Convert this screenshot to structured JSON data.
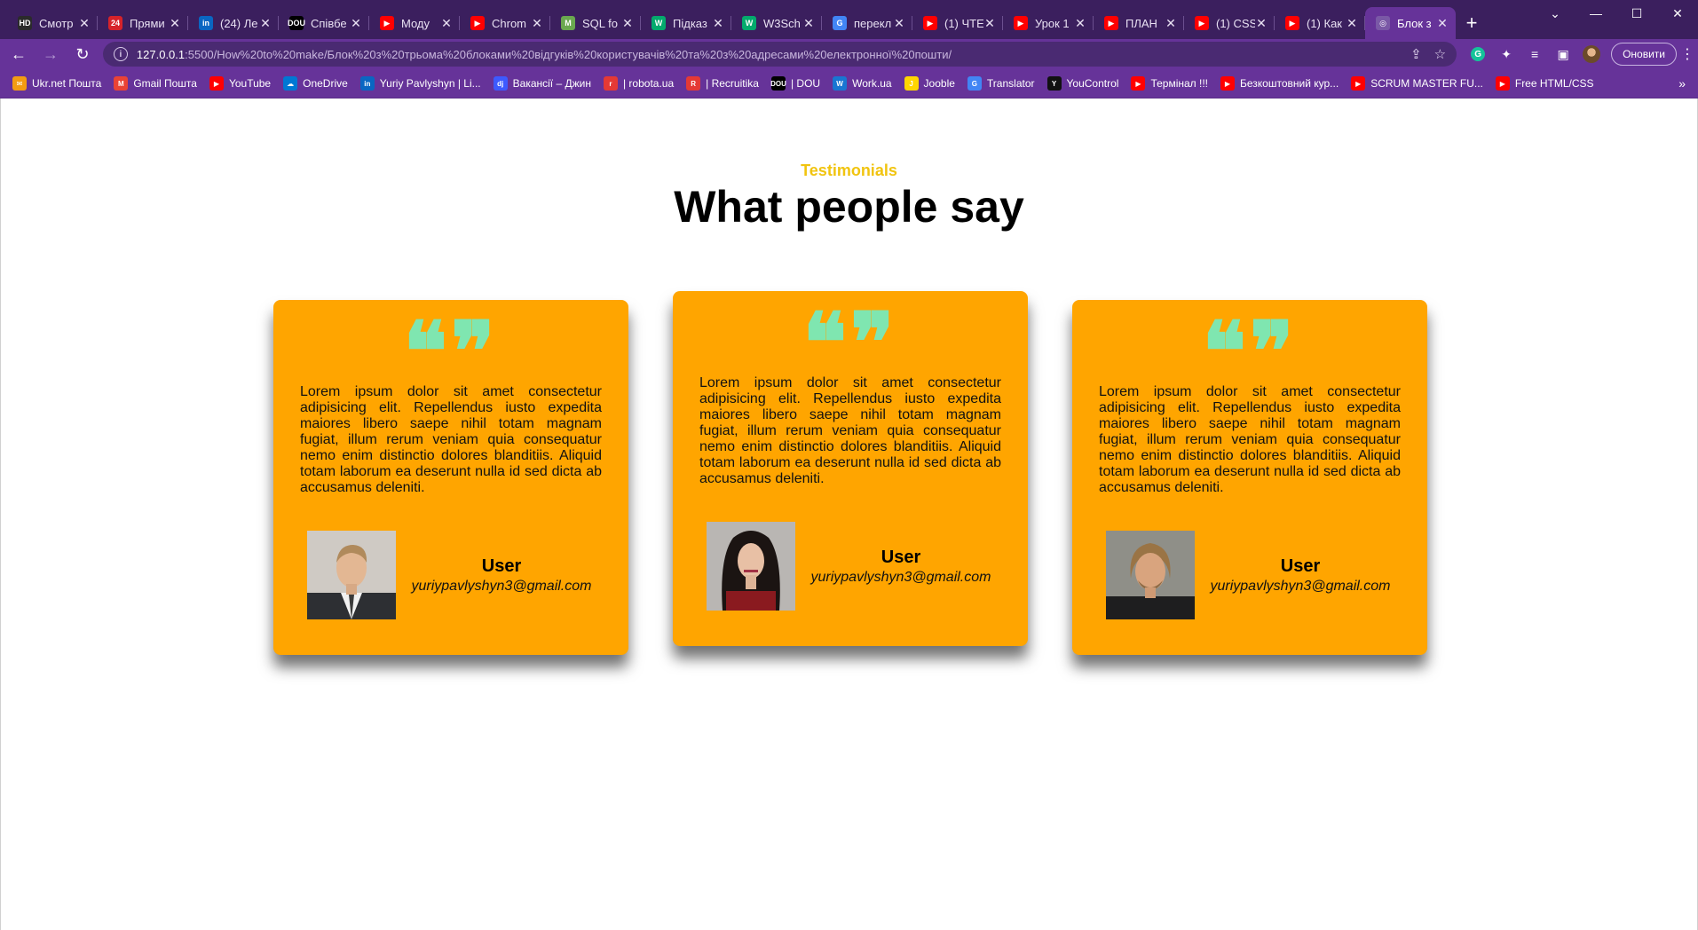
{
  "browser": {
    "tabs": [
      {
        "title": "Смотр",
        "fav_text": "HD",
        "fav_color": "#2b2b2b"
      },
      {
        "title": "Прями",
        "fav_text": "24",
        "fav_color": "#d6232a"
      },
      {
        "title": "(24) Ле",
        "fav_text": "in",
        "fav_color": "#0a66c2"
      },
      {
        "title": "Співбе",
        "fav_text": "DOU",
        "fav_color": "#000000"
      },
      {
        "title": "Моду",
        "fav_text": "▶",
        "fav_color": "#ff0000"
      },
      {
        "title": "Chrom",
        "fav_text": "▶",
        "fav_color": "#ff0000"
      },
      {
        "title": "SQL fo",
        "fav_text": "M",
        "fav_color": "#6aa84f"
      },
      {
        "title": "Підказ",
        "fav_text": "W",
        "fav_color": "#04aa6d"
      },
      {
        "title": "W3Sch",
        "fav_text": "W",
        "fav_color": "#04aa6d"
      },
      {
        "title": "перекл",
        "fav_text": "G",
        "fav_color": "#4285f4"
      },
      {
        "title": "(1) ЧТЕ",
        "fav_text": "▶",
        "fav_color": "#ff0000"
      },
      {
        "title": "Урок 1",
        "fav_text": "▶",
        "fav_color": "#ff0000"
      },
      {
        "title": "ПЛАН",
        "fav_text": "▶",
        "fav_color": "#ff0000"
      },
      {
        "title": "(1) CSS",
        "fav_text": "▶",
        "fav_color": "#ff0000"
      },
      {
        "title": "(1) Как",
        "fav_text": "▶",
        "fav_color": "#ff0000"
      },
      {
        "title": "Блок з",
        "fav_text": "◎",
        "fav_color": "#7a58a6",
        "active": true
      }
    ],
    "new_tab": "+",
    "close_glyph": "✕",
    "address": {
      "host": "127.0.0.1",
      "rest": ":5500/How%20to%20make/Блок%20з%20трьома%20блоками%20відгуків%20користувачів%20та%20з%20адресами%20електронної%20пошти/"
    },
    "update_label": "Оновити",
    "bookmarks": [
      {
        "label": "Ukr.net Пошта",
        "icon_color": "#f39c12",
        "icon_text": "✉"
      },
      {
        "label": "Gmail Пошта",
        "icon_color": "#ea4335",
        "icon_text": "M"
      },
      {
        "label": "YouTube",
        "icon_color": "#ff0000",
        "icon_text": "▶"
      },
      {
        "label": "OneDrive",
        "icon_color": "#0078d4",
        "icon_text": "☁"
      },
      {
        "label": "Yuriy Pavlyshyn | Li...",
        "icon_color": "#0a66c2",
        "icon_text": "in"
      },
      {
        "label": "Вакансії – Джин",
        "icon_color": "#3d5afe",
        "icon_text": "dj"
      },
      {
        "label": "| robota.ua",
        "icon_color": "#e53935",
        "icon_text": "r"
      },
      {
        "label": "| Recruitika",
        "icon_color": "#e53935",
        "icon_text": "R"
      },
      {
        "label": "| DOU",
        "icon_color": "#000000",
        "icon_text": "DOU"
      },
      {
        "label": "Work.ua",
        "icon_color": "#1976d2",
        "icon_text": "W"
      },
      {
        "label": "Jooble",
        "icon_color": "#ffd600",
        "icon_text": "J"
      },
      {
        "label": "Translator",
        "icon_color": "#4285f4",
        "icon_text": "G"
      },
      {
        "label": "YouControl",
        "icon_color": "#111111",
        "icon_text": "Y"
      },
      {
        "label": "Термінал !!!",
        "icon_color": "#ff0000",
        "icon_text": "▶"
      },
      {
        "label": "Безкоштовний кур...",
        "icon_color": "#ff0000",
        "icon_text": "▶"
      },
      {
        "label": "SCRUM MASTER FU...",
        "icon_color": "#ff0000",
        "icon_text": "▶"
      },
      {
        "label": "Free HTML/CSS",
        "icon_color": "#ff0000",
        "icon_text": "▶"
      }
    ],
    "bookmarks_more": "»"
  },
  "page": {
    "eyebrow": "Testimonials",
    "heading": "What people say",
    "quote_mark": "❝❞",
    "colors": {
      "card": "#ffa500",
      "quote": "#7fe6b0",
      "eyebrow": "#f1c40f"
    },
    "cards": [
      {
        "text": "Lorem ipsum dolor sit amet consectetur adipisicing elit. Repellendus iusto expedita maiores libero saepe nihil totam magnam fugiat, illum rerum veniam quia consequatur nemo enim distinctio dolores blanditiis. Aliquid totam laborum ea deserunt nulla id sed dicta ab accusamus deleniti.",
        "name": "User",
        "email": "yuriypavlyshyn3@gmail.com",
        "photo": "man-suit-portrait"
      },
      {
        "text": "Lorem ipsum dolor sit amet consectetur adipisicing elit. Repellendus iusto expedita maiores libero saepe nihil totam magnam fugiat, illum rerum veniam quia consequatur nemo enim distinctio dolores blanditiis. Aliquid totam laborum ea deserunt nulla id sed dicta ab accusamus deleniti.",
        "name": "User",
        "email": "yuriypavlyshyn3@gmail.com",
        "photo": "woman-dark-hair-portrait"
      },
      {
        "text": "Lorem ipsum dolor sit amet consectetur adipisicing elit. Repellendus iusto expedita maiores libero saepe nihil totam magnam fugiat, illum rerum veniam quia consequatur nemo enim distinctio dolores blanditiis. Aliquid totam laborum ea deserunt nulla id sed dicta ab accusamus deleniti.",
        "name": "User",
        "email": "yuriypavlyshyn3@gmail.com",
        "photo": "man-long-hair-portrait"
      }
    ]
  }
}
